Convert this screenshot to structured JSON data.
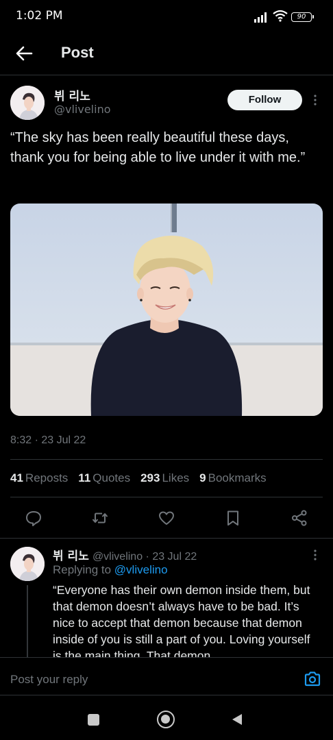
{
  "status_bar": {
    "time": "1:02 PM",
    "battery": "90"
  },
  "header": {
    "title": "Post"
  },
  "author": {
    "name": "뷔 리노",
    "handle": "@vlivelino",
    "follow_label": "Follow"
  },
  "tweet": {
    "text": "“The sky has been really beautiful these days, thank you for being able to live under it with me.”",
    "timestamp": "8:32 · 23 Jul 22"
  },
  "stats": [
    {
      "count": "41",
      "label": "Reposts"
    },
    {
      "count": "11",
      "label": "Quotes"
    },
    {
      "count": "293",
      "label": "Likes"
    },
    {
      "count": "9",
      "label": "Bookmarks"
    }
  ],
  "actions": [
    "reply-icon",
    "repost-icon",
    "like-icon",
    "bookmark-icon",
    "share-icon"
  ],
  "reply": {
    "name": "뷔 리노",
    "meta": "@vlivelino · 23 Jul 22",
    "replying_prefix": "Replying to",
    "replying_to": "@vlivelino",
    "text": "“Everyone has their own demon inside them, but that demon doesn’t always have to be bad. It’s nice to accept that demon because that demon inside of you is still a part of you. Loving yourself is the main thing. That demon"
  },
  "composer": {
    "placeholder": "Post your reply"
  },
  "colors": {
    "background": "#000000",
    "accent": "#1d9bf0",
    "muted": "#71767b",
    "text": "#e7e9ea"
  }
}
